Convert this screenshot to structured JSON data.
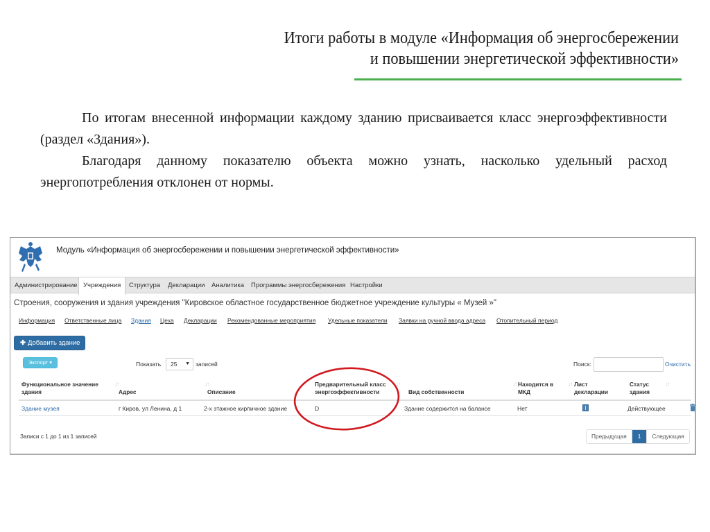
{
  "slide": {
    "title_line1": "Итоги работы в модуле «Информация об энергосбережении",
    "title_line2": "и повышении энергетической эффективности»",
    "paragraph1": "По итогам внесенной информации каждому зданию присваивается класс энергоэффективности (раздел «Здания»).",
    "paragraph2": "Благодаря данному показателю объекта можно узнать, насколько удельный расход энергопотребления отклонен от нормы.",
    "accent_color": "#4caf50"
  },
  "app": {
    "logo": "russian-coat-of-arms-icon",
    "title": "Модуль «Информация об энергосбережении и повышении энергетической эффективности»",
    "tabs": [
      {
        "label": "Администрирование",
        "active": false
      },
      {
        "label": "Учреждения",
        "active": true
      },
      {
        "label": "Структура",
        "active": false
      },
      {
        "label": "Декларации",
        "active": false
      },
      {
        "label": "Аналитика",
        "active": false
      },
      {
        "label": "Программы энергосбережения",
        "active": false
      },
      {
        "label": "Настройки",
        "active": false
      }
    ],
    "section_title": "Строения, сооружения и здания учреждения \"Кировское областное государственное бюджетное учреждение культуры « Музей »\"",
    "subnav": [
      {
        "label": "Информация",
        "active": false
      },
      {
        "label": "Ответственные лица",
        "active": false
      },
      {
        "label": "Здания",
        "active": true
      },
      {
        "label": "Цеха",
        "active": false
      },
      {
        "label": "Декларации",
        "active": false
      },
      {
        "label": "Рекомендованные мероприятия",
        "active": false
      },
      {
        "label": "Удельные показатели",
        "active": false
      },
      {
        "label": "Заявки на ручной ввода адреса",
        "active": false
      },
      {
        "label": "Отопительный период",
        "active": false
      }
    ],
    "add_button": "Добавить здание",
    "export_button": "Экспорт",
    "show_label": "Показать",
    "page_size": "25",
    "records_label": "записей",
    "search_label": "Поиск:",
    "search_value": "",
    "clear_link": "Очистить",
    "primary_color": "#2e6da4",
    "info_color": "#5bc0de"
  },
  "table": {
    "columns": [
      {
        "line1": "Функциональное значение",
        "line2": "здания"
      },
      {
        "line1": "",
        "line2": "Адрес"
      },
      {
        "line1": "",
        "line2": "Описание"
      },
      {
        "line1": "Предварительный класс",
        "line2": "энергоэффективности"
      },
      {
        "line1": "",
        "line2": "Вид собственности"
      },
      {
        "line1": "Находится в",
        "line2": "МКД"
      },
      {
        "line1": "Лист",
        "line2": "декларации"
      },
      {
        "line1": "Статус",
        "line2": "здания"
      }
    ],
    "rows": [
      {
        "function": "Здание музея",
        "address": "г Киров, ул Ленина, д 1",
        "description": "2-х этажное кирпичное здание",
        "energy_class": "D",
        "ownership": "Здание содержится на балансе",
        "in_mkd": "Нет",
        "declaration_icon": "document-icon",
        "status": "Действующее",
        "action_icon": "trash-icon"
      }
    ],
    "info": "Записи с 1 до 1 из 1 записей",
    "pager": {
      "prev": "Предыдущая",
      "current": "1",
      "next": "Следующая"
    }
  },
  "annotation": {
    "color": "#d0191f",
    "target": "energy-class-column"
  }
}
